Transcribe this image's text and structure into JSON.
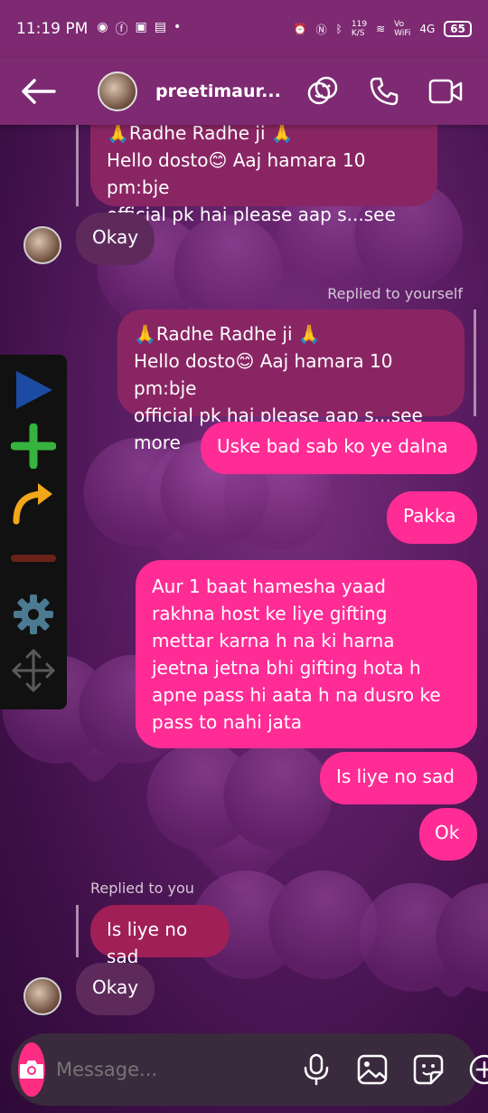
{
  "status_bar": {
    "time": "11:19 PM",
    "net_speed": "119\nK/S",
    "volte": "Vo\nWiFi",
    "signal": "4G",
    "battery": "65"
  },
  "header": {
    "username": "preetimaur..."
  },
  "messages": {
    "m1_line1": "🙏Radhe Radhe ji 🙏",
    "m1_line2": "Hello dosto😊 Aaj hamara 10 pm:bje",
    "m1_line3": "official pk hai please aap s...see more",
    "m2": "Okay",
    "m3_label": "Replied to yourself",
    "m3_line1": "🙏Radhe Radhe ji 🙏",
    "m3_line2": "Hello dosto😊 Aaj hamara 10 pm:bje",
    "m3_line3": "official pk hai please aap s...see more",
    "m4": "Uske bad sab ko ye dalna",
    "m5": "Pakka",
    "m6_line1": "Aur 1 baat hamesha yaad",
    "m6_line2": "rakhna host ke liye gifting",
    "m6_line3": "mettar karna h na ki harna",
    "m6_line4": "jeetna jetna bhi gifting hota h",
    "m6_line5": "apne pass hi aata h na dusro ke",
    "m6_line6": "pass to nahi jata",
    "m7": "Is liye no sad",
    "m8": "Ok",
    "m9_label": "Replied to you",
    "m9_quote": "Is liye no sad",
    "m10": "Okay"
  },
  "composer": {
    "placeholder": "Message..."
  },
  "colors": {
    "header_bg": "#7d2a72",
    "sent_bubble": "#ff2c95",
    "recv_bubble": "#5e2a5c",
    "camera": "#ff2c84"
  }
}
